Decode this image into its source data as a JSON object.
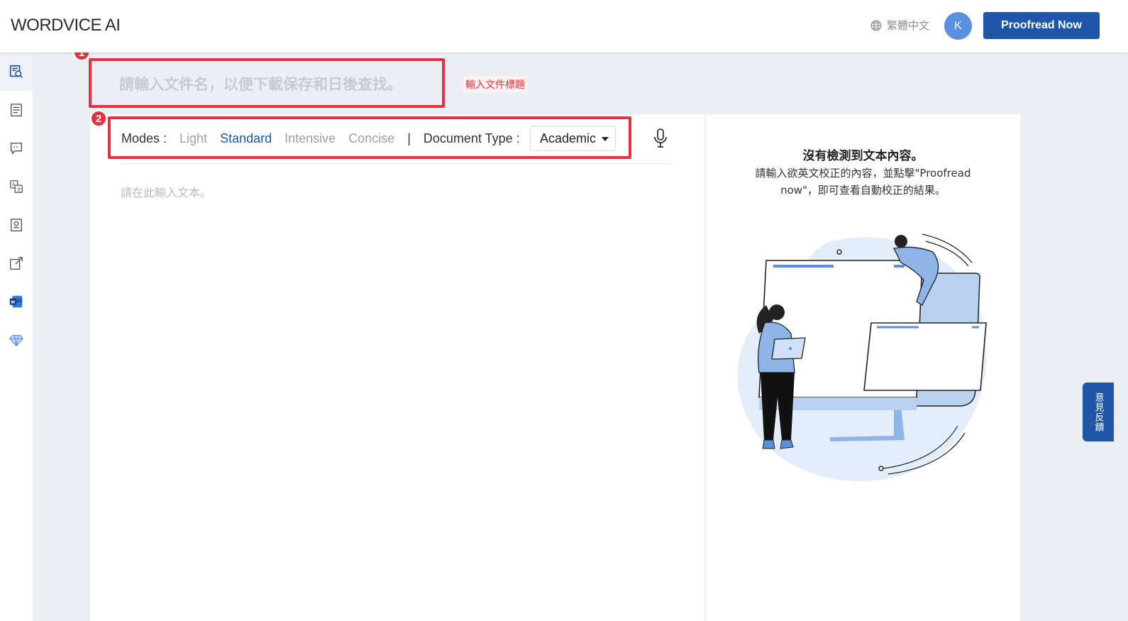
{
  "header": {
    "logo": "WORDVICE AI",
    "language": "繁體中文",
    "avatar_initial": "K",
    "proofread_button": "Proofread Now"
  },
  "sidebar": {
    "items": [
      {
        "icon": "proofread-search-icon",
        "active": true
      },
      {
        "icon": "document-list-icon",
        "active": false
      },
      {
        "icon": "chat-quote-icon",
        "active": false
      },
      {
        "icon": "translate-icon",
        "active": false
      },
      {
        "icon": "certificate-icon",
        "active": false
      },
      {
        "icon": "external-link-icon",
        "active": false
      },
      {
        "icon": "word-app-icon",
        "active": false
      },
      {
        "icon": "diamond-icon",
        "active": false
      }
    ]
  },
  "title_section": {
    "badge": "1",
    "placeholder": "請輸入文件名，以便下載保存和日後查找。",
    "annotation": "輸入文件標題"
  },
  "toolbar": {
    "badge": "2",
    "modes_label": "Modes :",
    "modes": [
      "Light",
      "Standard",
      "Intensive",
      "Concise"
    ],
    "active_mode": "Standard",
    "separator": "|",
    "doc_type_label": "Document Type :",
    "doc_type_value": "Academic"
  },
  "editor": {
    "placeholder": "請在此輸入文本。"
  },
  "result_panel": {
    "empty_title": "沒有檢測到文本內容。",
    "empty_desc": "請輸入欲英文校正的內容，並點擊\"Proofread now\"，即可查看自動校正的結果。"
  },
  "feedback": {
    "label": "意見反饋"
  },
  "colors": {
    "accent": "#1f56a8",
    "highlight": "#e8303f",
    "avatar": "#5b8fdf"
  }
}
